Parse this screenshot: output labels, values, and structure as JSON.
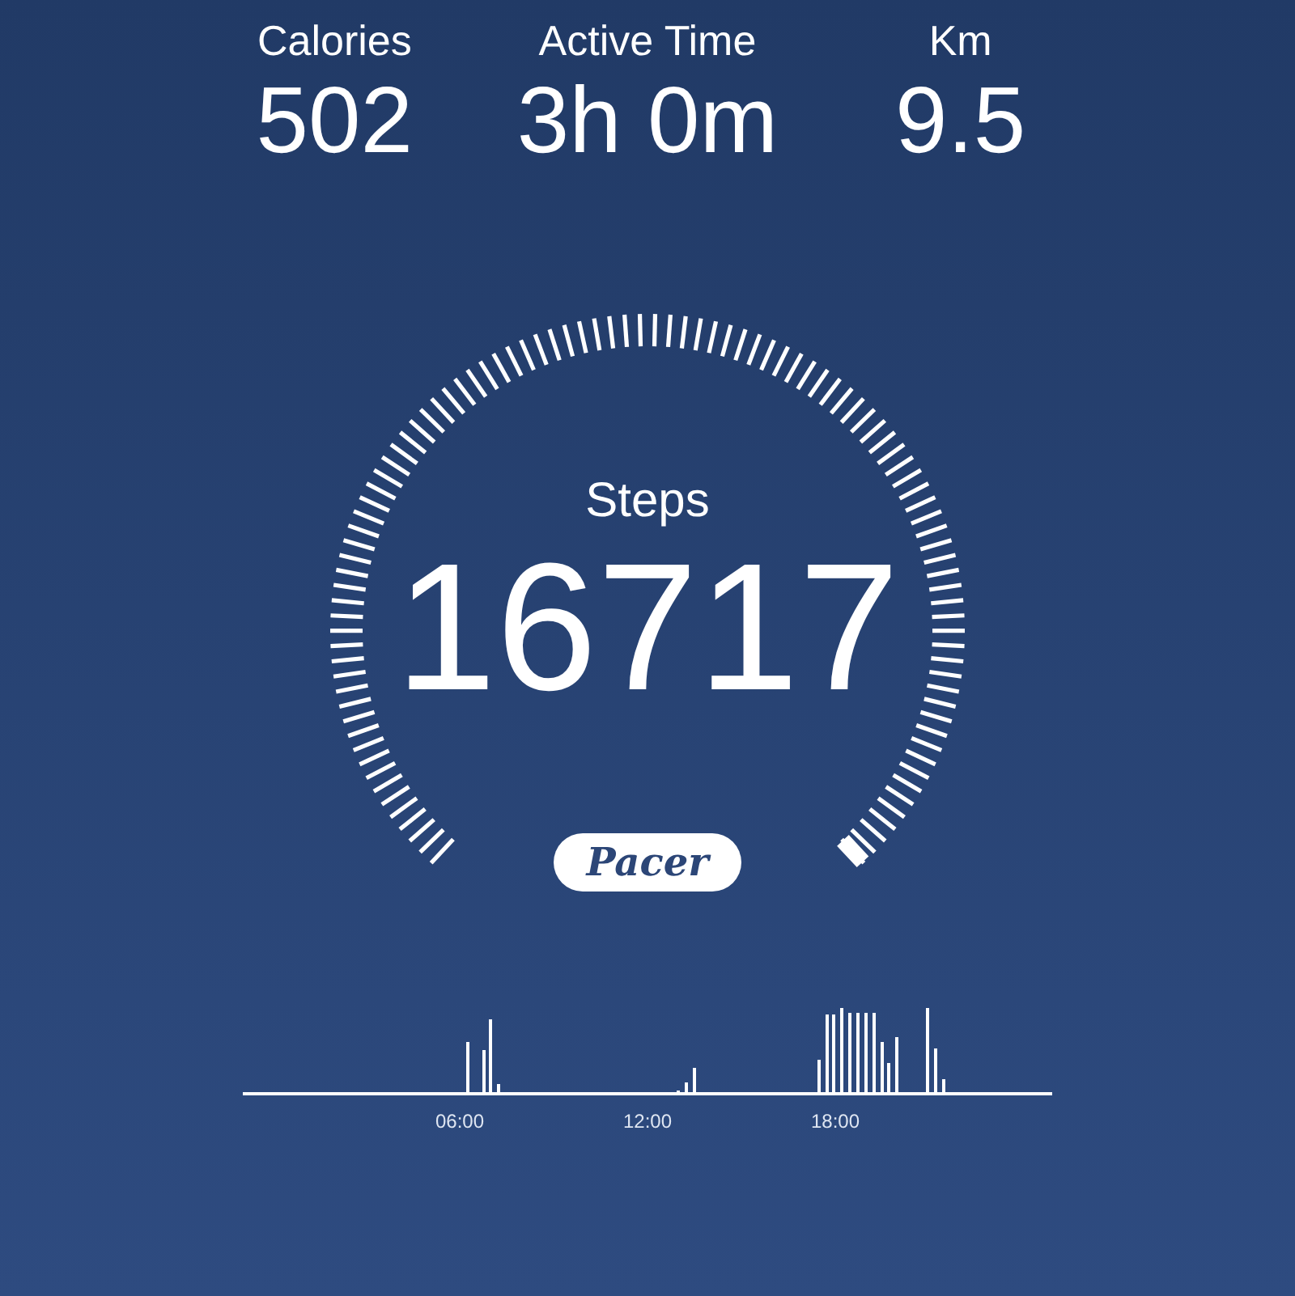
{
  "stats": [
    {
      "label": "Calories",
      "value": "502"
    },
    {
      "label": "Active Time",
      "value": "3h 0m"
    },
    {
      "label": "Km",
      "value": "9.5"
    }
  ],
  "gauge": {
    "label": "Steps",
    "value": "16717"
  },
  "logo": "Pacer",
  "activity_chart": {
    "time_labels": [
      "06:00",
      "12:00",
      "18:00"
    ]
  }
}
